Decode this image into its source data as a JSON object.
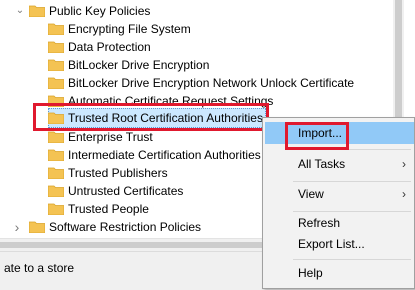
{
  "tree": {
    "root": {
      "label": "Public Key Policies",
      "expander": "⌄"
    },
    "children": [
      {
        "label": "Encrypting File System"
      },
      {
        "label": "Data Protection"
      },
      {
        "label": "BitLocker Drive Encryption"
      },
      {
        "label": "BitLocker Drive Encryption Network Unlock Certificate"
      },
      {
        "label": "Automatic Certificate Request Settings"
      },
      {
        "label": "Trusted Root Certification Authorities"
      },
      {
        "label": "Enterprise Trust"
      },
      {
        "label": "Intermediate Certification Authorities"
      },
      {
        "label": "Trusted Publishers"
      },
      {
        "label": "Untrusted Certificates"
      },
      {
        "label": "Trusted People"
      }
    ],
    "sibling": {
      "label": "Software Restriction Policies",
      "expander": "›"
    },
    "selected_index": 5
  },
  "status_bar": {
    "text": "ate to a store"
  },
  "context_menu": {
    "items": [
      {
        "label": "Import...",
        "highlighted": true
      },
      {
        "label": "All Tasks",
        "submenu_arrow": "›"
      },
      {
        "label": "View",
        "submenu_arrow": "›"
      },
      {
        "label": "Refresh"
      },
      {
        "label": "Export List..."
      },
      {
        "label": "Help"
      }
    ]
  },
  "colors": {
    "highlight_box": "#e0192e",
    "selection_bg": "#cce8ff",
    "menu_hover": "#91c9f7",
    "folder": "#f4c353"
  },
  "icons": {
    "folder": "folder-icon"
  }
}
